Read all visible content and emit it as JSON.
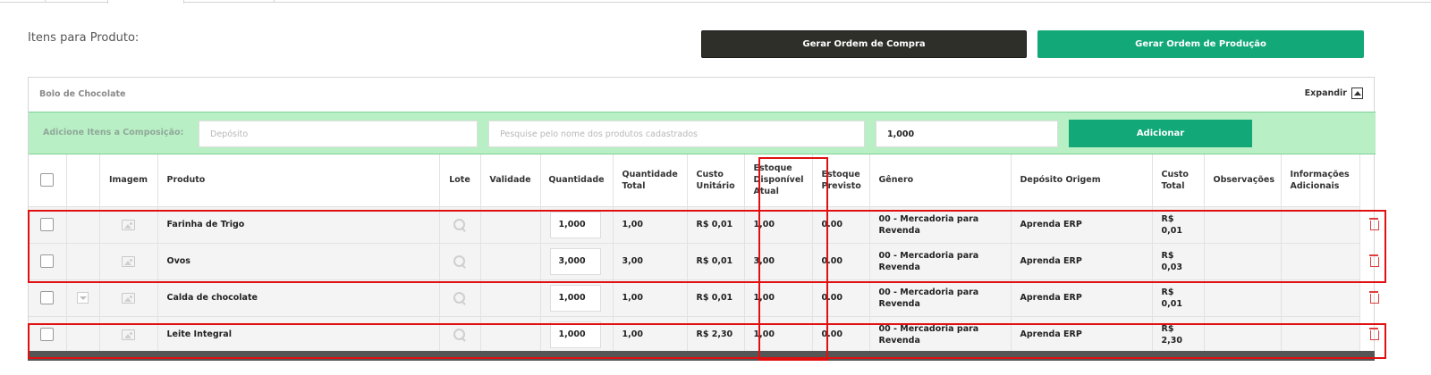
{
  "section_title": "Itens para Produto:",
  "buttons": {
    "ordem_compra": "Gerar Ordem de Compra",
    "ordem_producao": "Gerar Ordem de Produção"
  },
  "panel": {
    "title": "Bolo de Chocolate",
    "expand_label": "Expandir"
  },
  "addbar": {
    "label": "Adicione Itens a Composição:",
    "deposito_placeholder": "Depósito",
    "busca_placeholder": "Pesquise pelo nome dos produtos cadastrados",
    "quantidade_value": "1,000",
    "add_button": "Adicionar"
  },
  "columns": {
    "imagem": "Imagem",
    "produto": "Produto",
    "lote": "Lote",
    "validade": "Validade",
    "quantidade": "Quantidade",
    "quantidade_total_1": "Quantidade",
    "quantidade_total_2": "Total",
    "custo_unitario_1": "Custo",
    "custo_unitario_2": "Unitário",
    "estoque_atual_1": "Estoque",
    "estoque_atual_2": "Disponível",
    "estoque_atual_3": "Atual",
    "estoque_previsto_1": "Estoque",
    "estoque_previsto_2": "Previsto",
    "genero": "Gênero",
    "deposito_origem": "Depósito Origem",
    "custo_total_1": "Custo",
    "custo_total_2": "Total",
    "observacoes": "Observações",
    "info_adicionais_1": "Informações",
    "info_adicionais_2": "Adicionais"
  },
  "rows": [
    {
      "produto": "Farinha de Trigo",
      "quantidade": "1,000",
      "quantidade_total": "1,00",
      "custo_unitario": "R$ 0,01",
      "estoque_atual": "1,00",
      "estoque_previsto": "0.00",
      "genero_1": "00 - Mercadoria para",
      "genero_2": "Revenda",
      "deposito_origem": "Aprenda ERP",
      "custo_total": "R$ 0,01"
    },
    {
      "produto": "Ovos",
      "quantidade": "3,000",
      "quantidade_total": "3,00",
      "custo_unitario": "R$ 0,01",
      "estoque_atual": "3,00",
      "estoque_previsto": "0.00",
      "genero_1": "00 - Mercadoria para",
      "genero_2": "Revenda",
      "deposito_origem": "Aprenda ERP",
      "custo_total": "R$ 0,03"
    },
    {
      "produto": "Calda de chocolate",
      "quantidade": "1,000",
      "quantidade_total": "1,00",
      "custo_unitario": "R$ 0,01",
      "estoque_atual": "1,00",
      "estoque_previsto": "0.00",
      "genero_1": "00 - Mercadoria para",
      "genero_2": "Revenda",
      "deposito_origem": "Aprenda ERP",
      "custo_total": "R$ 0,01"
    },
    {
      "produto": "Leite Integral",
      "quantidade": "1,000",
      "quantidade_total": "1,00",
      "custo_unitario": "R$ 2,30",
      "estoque_atual": "1,00",
      "estoque_previsto": "0.00",
      "genero_1": "00 - Mercadoria para",
      "genero_2": "Revenda",
      "deposito_origem": "Aprenda ERP",
      "custo_total": "R$ 2,30"
    }
  ],
  "colors": {
    "primary_green": "#12a877",
    "dark_button": "#2f2f2a",
    "addbar_bg": "#b9efc4",
    "highlight_red": "#e01010",
    "delete_red": "#e03d3d"
  }
}
